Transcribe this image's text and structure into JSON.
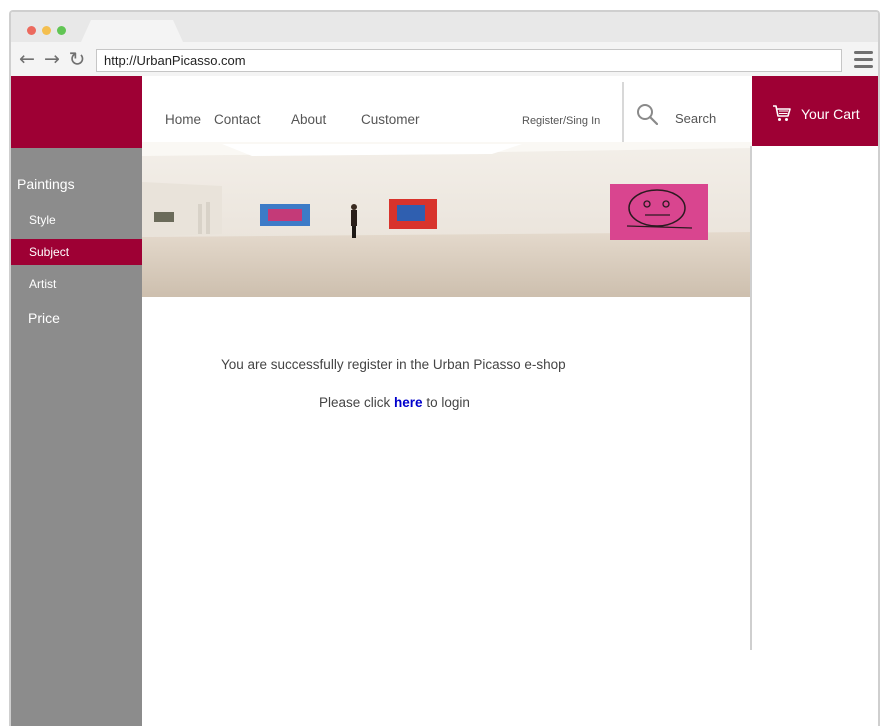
{
  "browser": {
    "url": "http://UrbanPicasso.com",
    "icons": [
      "back-arrow-icon",
      "forward-arrow-icon",
      "reload-icon",
      "hamburger-menu-icon"
    ]
  },
  "sidebar": {
    "title": "Paintings",
    "items": [
      {
        "label": "Style"
      },
      {
        "label": "Subject"
      },
      {
        "label": "Artist"
      }
    ],
    "price": "Price"
  },
  "nav": {
    "home": "Home",
    "contact": "Contact",
    "about": "About",
    "customer": "Customer",
    "register": "Register/Sing In",
    "search": "Search"
  },
  "cart": {
    "label": "Your Cart"
  },
  "main": {
    "message": "You are successfully register in the Urban Picasso e-shop",
    "login_prefix": "Please click ",
    "login_link": "here",
    "login_suffix": " to login"
  },
  "colors": {
    "brand": "#9e0034",
    "sidebar": "#8c8c8c",
    "link": "#0000cc"
  }
}
